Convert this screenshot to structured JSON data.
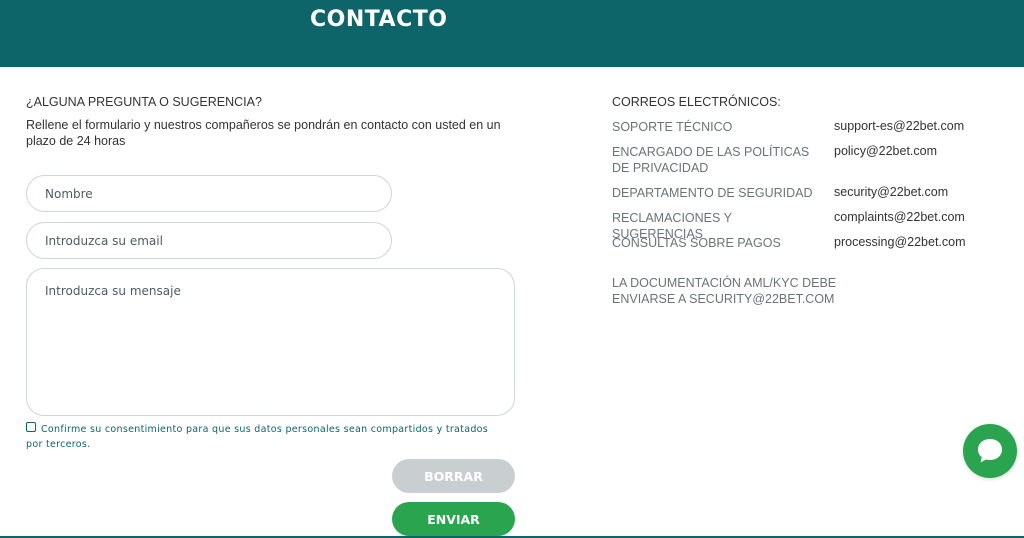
{
  "header": {
    "title": "CONTACTO"
  },
  "form": {
    "question": "¿ALGUNA PREGUNTA O SUGERENCIA?",
    "intro": "Rellene el formulario y nuestros compañeros se pondrán en contacto con usted en un plazo de 24 horas",
    "name_placeholder": "Nombre",
    "email_placeholder": "Introduzca su email",
    "message_placeholder": "Introduzca su mensaje",
    "consent_text": "Confirme su consentimiento para que sus datos personales sean compartidos y tratados por terceros.",
    "clear_label": "BORRAR",
    "send_label": "ENVIAR"
  },
  "emails": {
    "title": "CORREOS ELECTRÓNICOS:",
    "rows": [
      {
        "label": "SOPORTE TÉCNICO",
        "address": "support-es@22bet.com"
      },
      {
        "label": "ENCARGADO DE LAS POLÍTICAS DE PRIVACIDAD",
        "address": "policy@22bet.com"
      },
      {
        "label": "DEPARTAMENTO DE SEGURIDAD",
        "address": "security@22bet.com"
      },
      {
        "label": "RECLAMACIONES Y SUGERENCIAS",
        "address": "complaints@22bet.com"
      },
      {
        "label": "CONSULTAS SOBRE PAGOS",
        "address": "processing@22bet.com"
      }
    ],
    "aml_note": "LA DOCUMENTACIÓN AML/KYC DEBE ENVIARSE A SECURITY@22BET.COM"
  },
  "chat": {
    "icon": "chat-bubble-icon"
  },
  "colors": {
    "header": "#0d6469",
    "accent_green": "#2aa44f",
    "button_disabled": "#c9cfd1"
  }
}
